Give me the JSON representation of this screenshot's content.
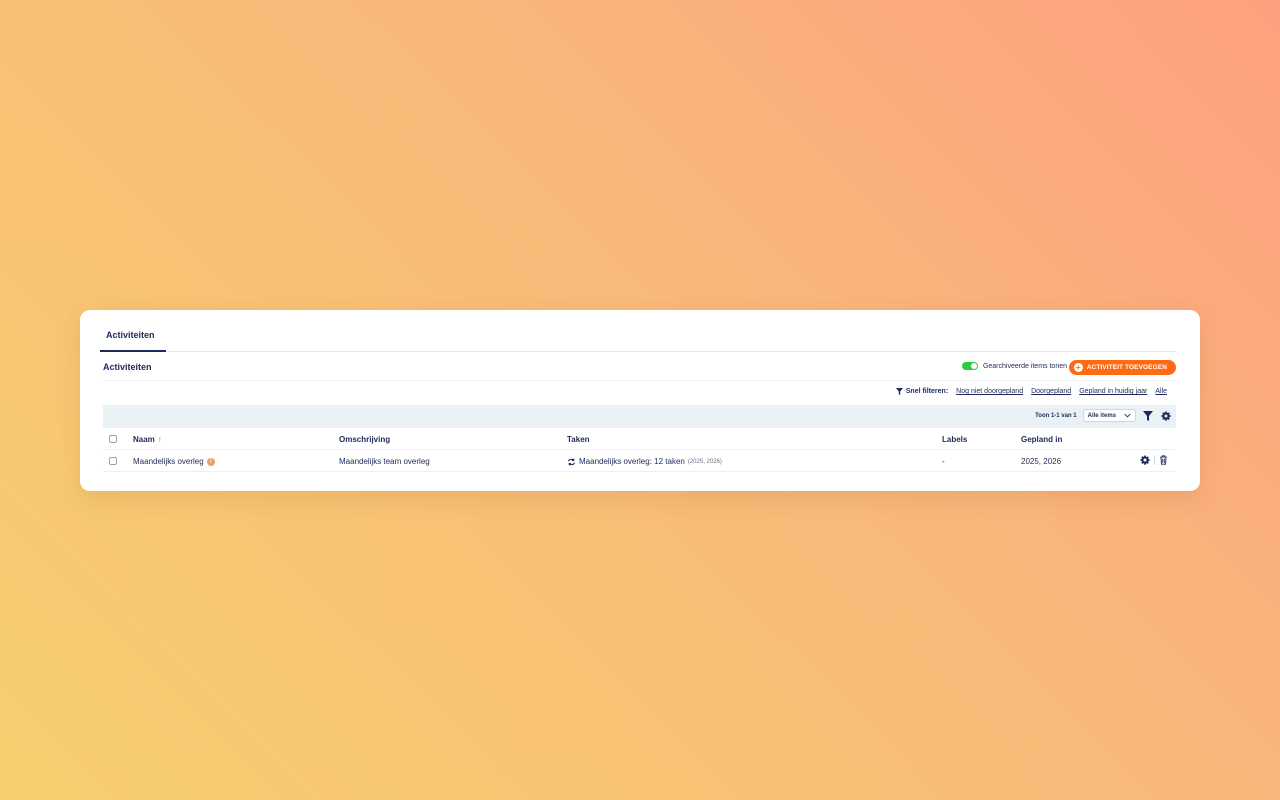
{
  "tabs": [
    {
      "label": "Activiteiten"
    }
  ],
  "section": {
    "title": "Activiteiten"
  },
  "toggle": {
    "label": "Gearchiveerde items tonen",
    "on": true
  },
  "add_button": {
    "label": "ACTIVITEIT TOEVOEGEN"
  },
  "quick_filter": {
    "label": "Snel filteren:",
    "links": [
      "Nog niet doorgepland",
      "Doorgepland",
      "Gepland in huidig jaar",
      "Alle"
    ]
  },
  "toolbar": {
    "count_text": "Toon 1-1 van 1",
    "select_value": "Alle items"
  },
  "table": {
    "headers": {
      "naam": "Naam",
      "omschrijving": "Omschrijving",
      "taken": "Taken",
      "labels": "Labels",
      "gepland": "Gepland in"
    },
    "rows": [
      {
        "naam": "Maandelijks overleg",
        "omschrijving": "Maandelijks team overleg",
        "taken": "Maandelijks overleg: 12 taken",
        "taken_years": "(2025, 2026)",
        "labels": "-",
        "gepland": "2025, 2026"
      }
    ]
  },
  "colors": {
    "accent": "#ff6a13",
    "navy": "#1f2a5a",
    "toggle_on": "#2ecc40",
    "toolbar_bg": "#e9f1f5"
  }
}
